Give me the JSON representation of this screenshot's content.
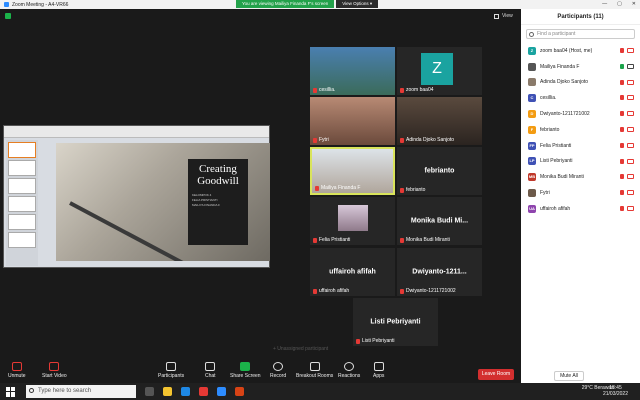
{
  "window": {
    "title": "Zoom Meeting - A4-VR66",
    "controls": [
      "—",
      "▢",
      "✕"
    ]
  },
  "banner": {
    "viewing": "You are viewing Mailiya Finanda F's screen",
    "view_options": "View Options ▾"
  },
  "view_button": "View",
  "slide": {
    "title_line1": "Creating",
    "title_line2": "Goodwill",
    "presenters": [
      "KELOMPOK 4",
      "FELIA PRISTIANTI",
      "MAILIYA FINANDA F"
    ]
  },
  "tiles": [
    {
      "id": "cesillia",
      "label": "cesillia."
    },
    {
      "id": "zoombaa04",
      "label": "zoom baa04",
      "avatar": "Z"
    },
    {
      "id": "fytri",
      "label": "Fytri"
    },
    {
      "id": "adinda",
      "label": "Adinda Djoko Sanjoto"
    },
    {
      "id": "mailiya",
      "label": "Mailiya Finanda F"
    },
    {
      "id": "febrianto",
      "label": "febrianto",
      "center": "febrianto"
    },
    {
      "id": "felia",
      "label": "Felia Pristianti"
    },
    {
      "id": "monika",
      "label": "Monika Budi Miranti",
      "center": "Monika Budi Mi..."
    },
    {
      "id": "uffairoh",
      "label": "uffairoh afifah",
      "center": "uffairoh afifah"
    },
    {
      "id": "dwiyanto",
      "label": "Dwiyanto-1211721002",
      "center": "Dwiyanto-1211..."
    },
    {
      "id": "listi",
      "label": "Listi Pebriyanti",
      "center": "Listi Pebriyanti"
    }
  ],
  "unassigned": "+ Unassigned participant",
  "participants": {
    "title": "Participants (11)",
    "search_placeholder": "Find a participant",
    "list": [
      {
        "initials": "Z",
        "name": "zoom baa04 (Host, me)",
        "color": "#1aa3a0"
      },
      {
        "initials": "",
        "name": "Mailiya Finanda F",
        "color": "#555555"
      },
      {
        "initials": "",
        "name": "Adinda Djoko Sanjoto",
        "color": "#8a7a6a"
      },
      {
        "initials": "C",
        "name": "cesillia.",
        "color": "#3f51b5"
      },
      {
        "initials": "D",
        "name": "Dwiyanto-1211721002",
        "color": "#f39c12"
      },
      {
        "initials": "F",
        "name": "febrianto",
        "color": "#f39c12"
      },
      {
        "initials": "FP",
        "name": "Felia Pristianti",
        "color": "#3f51b5"
      },
      {
        "initials": "LP",
        "name": "Listi Pebriyanti",
        "color": "#3f51b5"
      },
      {
        "initials": "MB",
        "name": "Monika Budi Miranti",
        "color": "#c0392b"
      },
      {
        "initials": "",
        "name": "Fytri",
        "color": "#6d5a4a"
      },
      {
        "initials": "UA",
        "name": "uffairoh afifah",
        "color": "#8e44ad"
      }
    ],
    "mute_all": "Mute All"
  },
  "toolbar": {
    "unmute": "Unmute",
    "start_video": "Start Video",
    "participants": "Participants",
    "participants_count": "11",
    "chat": "Chat",
    "share_screen": "Share Screen",
    "record": "Record",
    "breakout_rooms": "Breakout Rooms",
    "reactions": "Reactions",
    "apps": "Apps",
    "leave": "Leave Room"
  },
  "taskbar": {
    "search_placeholder": "Type here to search",
    "weather": "29°C  Berawan",
    "time": "18:45",
    "date": "21/03/2022"
  }
}
